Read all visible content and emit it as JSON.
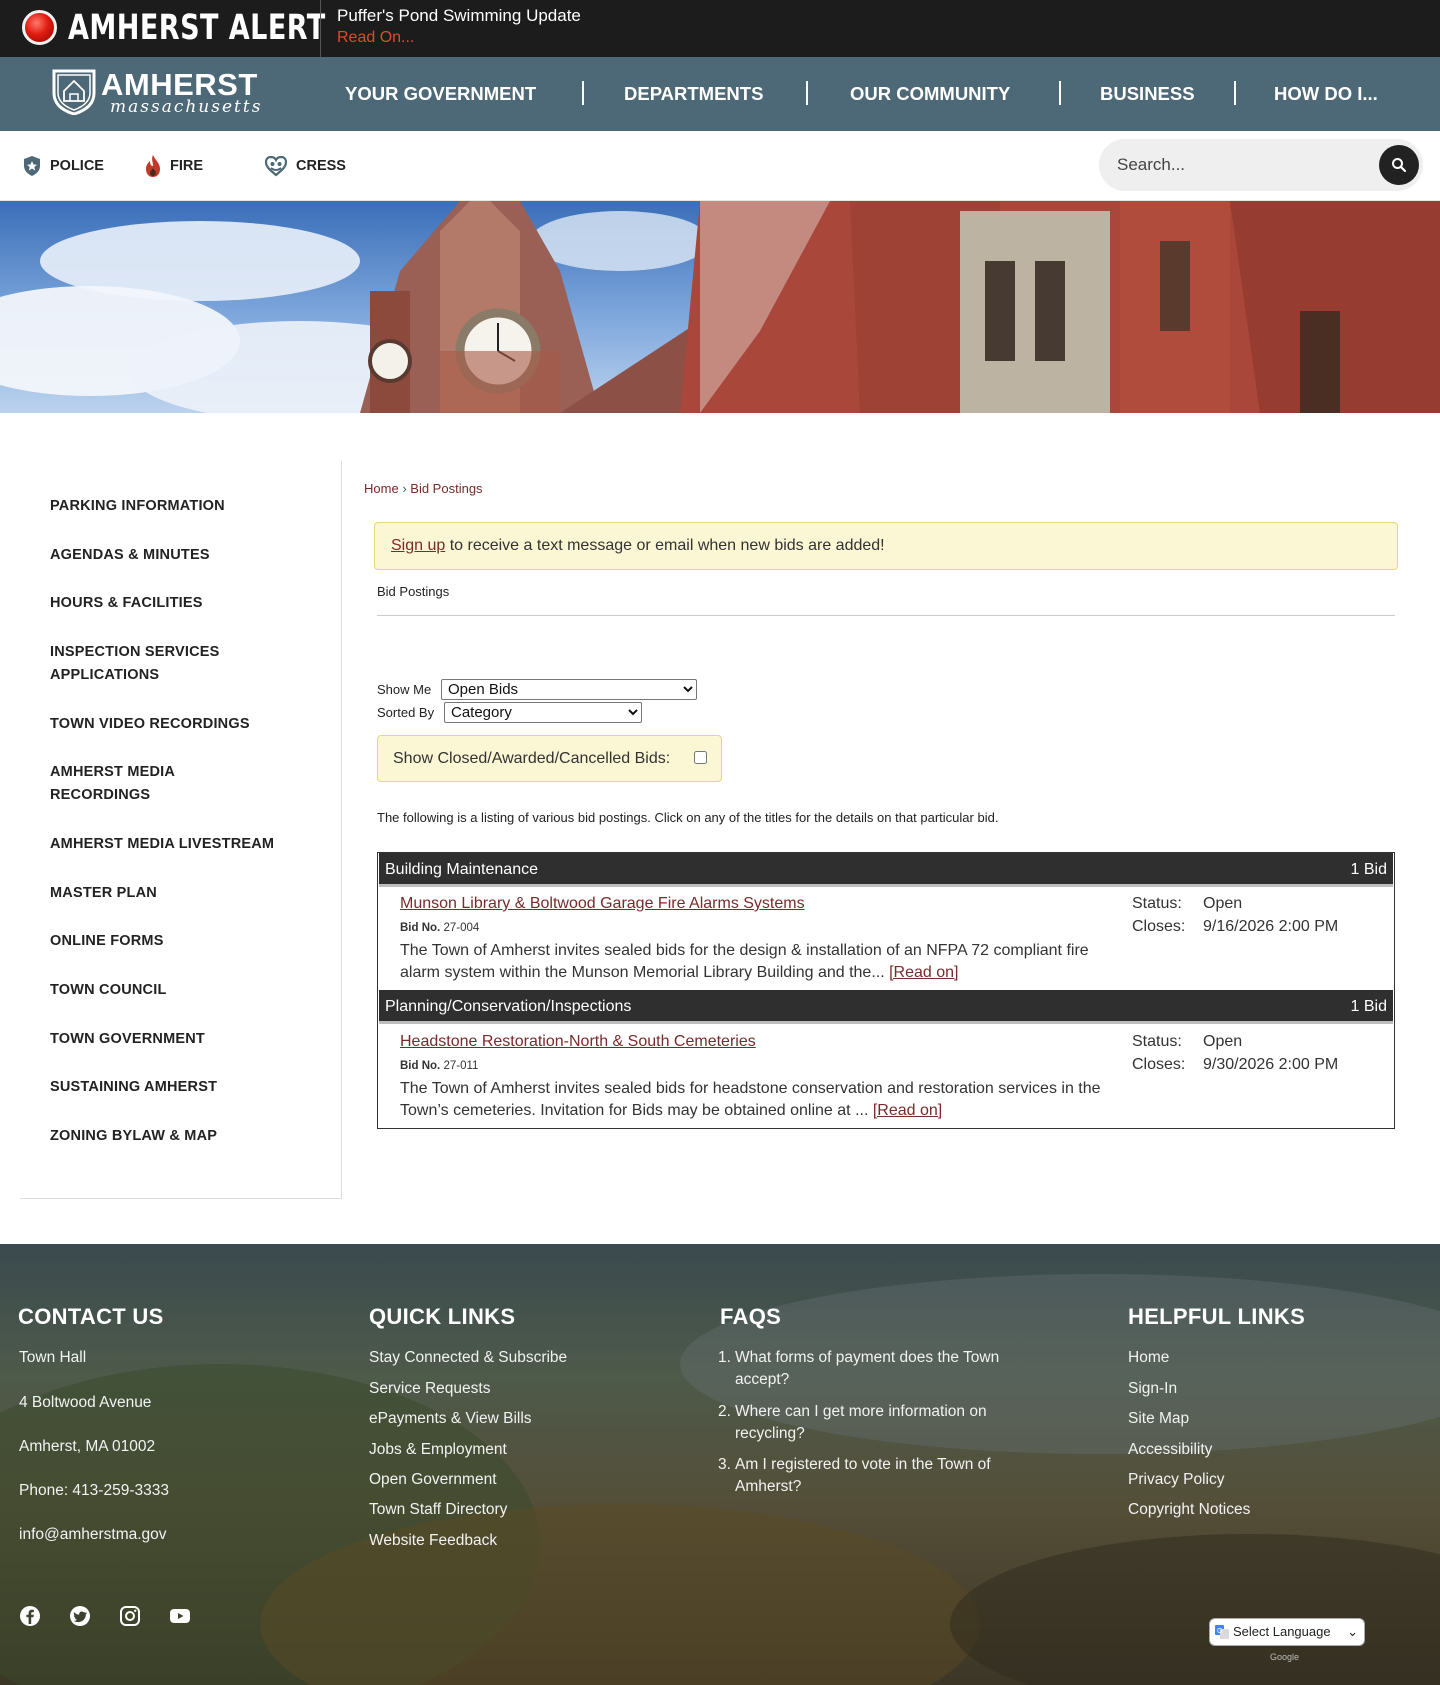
{
  "alert": {
    "title": "AMHERST ALERT",
    "message": "Puffer's Pond Swimming Update",
    "link": "Read On..."
  },
  "header": {
    "logo_word": "AMHERST",
    "logo_script": "massachusetts",
    "nav": [
      "YOUR GOVERNMENT",
      "DEPARTMENTS",
      "OUR COMMUNITY",
      "BUSINESS",
      "HOW DO I..."
    ]
  },
  "utility": {
    "links": [
      {
        "label": "POLICE",
        "icon": "police-badge-icon"
      },
      {
        "label": "FIRE",
        "icon": "flame-icon"
      },
      {
        "label": "CRESS",
        "icon": "heart-hands-icon"
      }
    ],
    "search_placeholder": "Search..."
  },
  "sidebar": {
    "items": [
      "PARKING INFORMATION",
      "AGENDAS & MINUTES",
      "HOURS & FACILITIES",
      "INSPECTION SERVICES APPLICATIONS",
      "TOWN VIDEO RECORDINGS",
      "AMHERST MEDIA RECORDINGS",
      "AMHERST MEDIA LIVESTREAM",
      "MASTER PLAN",
      "ONLINE FORMS",
      "TOWN COUNCIL",
      "TOWN GOVERNMENT",
      "SUSTAINING AMHERST",
      "ZONING BYLAW & MAP"
    ]
  },
  "main": {
    "breadcrumb": {
      "home": "Home",
      "sep": "›",
      "current": "Bid Postings"
    },
    "notice_link": "Sign up",
    "notice_text": " to receive a text message or email when new bids are added!",
    "page_title": "Bid Postings",
    "show_me_label": "Show Me",
    "show_me_value": "Open Bids",
    "sorted_by_label": "Sorted By",
    "sorted_by_value": "Category",
    "closed_label": "Show Closed/Awarded/Cancelled Bids:",
    "intro": "The following is a listing of various bid postings. Click on any of the titles for the details on that particular bid.",
    "categories": [
      {
        "name": "Building Maintenance",
        "count": "1 Bid",
        "bid": {
          "title": "Munson Library & Boltwood Garage Fire Alarms Systems",
          "bid_no_label": "Bid No.",
          "bid_no": "27-004",
          "description": "The Town of Amherst invites sealed bids for the design & installation of an NFPA 72 compliant fire alarm system within the Munson Memorial Library Building and the... ",
          "read_on": "[Read on]",
          "status_label": "Status:",
          "status": "Open",
          "closes_label": "Closes:",
          "closes": "9/16/2026 2:00 PM"
        }
      },
      {
        "name": "Planning/Conservation/Inspections",
        "count": "1 Bid",
        "bid": {
          "title": "Headstone Restoration-North & South Cemeteries",
          "bid_no_label": "Bid No.",
          "bid_no": "27-011",
          "description": "The Town of Amherst invites sealed bids for headstone conservation and restoration services in the Town’s cemeteries. Invitation for Bids may be obtained online at ... ",
          "read_on": "[Read on]",
          "status_label": "Status:",
          "status": "Open",
          "closes_label": "Closes:",
          "closes": "9/30/2026 2:00 PM"
        }
      }
    ]
  },
  "footer": {
    "contact": {
      "heading": "CONTACT US",
      "lines": [
        "Town Hall",
        "4 Boltwood Avenue",
        "Amherst, MA 01002",
        "Phone: 413-259-3333",
        "info@amherstma.gov"
      ]
    },
    "quick_links": {
      "heading": "QUICK LINKS",
      "items": [
        "Stay Connected & Subscribe",
        "Service Requests",
        "ePayments & View Bills",
        "Jobs & Employment",
        "Open Government",
        "Town Staff Directory",
        "Website Feedback"
      ]
    },
    "faqs": {
      "heading": "FAQS",
      "items": [
        {
          "n": "1.",
          "text": "What forms of payment does the Town accept?"
        },
        {
          "n": "2.",
          "text": "Where can I get more information on recycling?"
        },
        {
          "n": "3.",
          "text": "Am I registered to vote in the Town of Amherst?"
        }
      ]
    },
    "helpful_links": {
      "heading": "HELPFUL LINKS",
      "items": [
        "Home",
        "Sign-In",
        "Site Map",
        "Accessibility",
        "Privacy Policy",
        "Copyright Notices"
      ]
    },
    "social": [
      "facebook-icon",
      "twitter-icon",
      "instagram-icon",
      "youtube-icon"
    ],
    "language_select": "Select Language",
    "powered_by": "Google"
  }
}
